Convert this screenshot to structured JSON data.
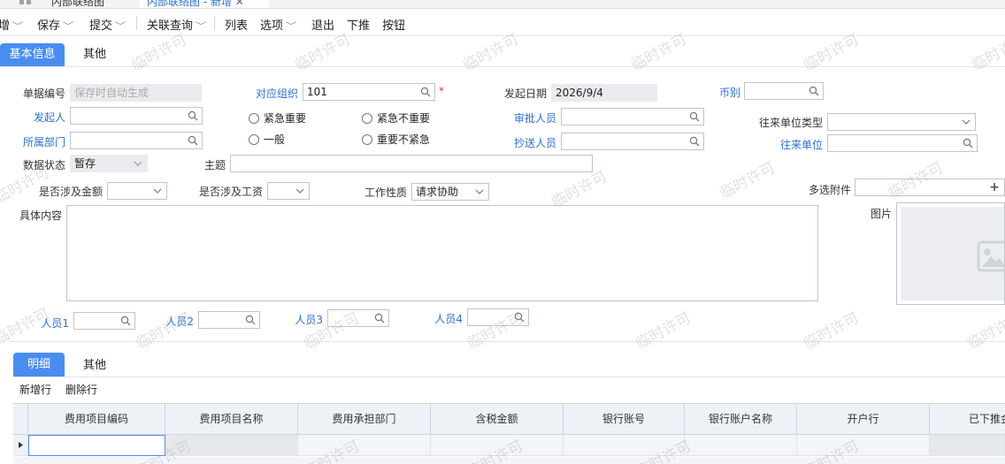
{
  "tabs": {
    "tab1": "内部联络图",
    "tab2": "内部联络图 - 新增"
  },
  "toolbar": {
    "items": [
      "增",
      "保存",
      "提交",
      "关联查询",
      "列表",
      "选项",
      "退出",
      "下推",
      "按钮"
    ]
  },
  "section_tabs": {
    "basic": "基本信息",
    "other": "其他"
  },
  "form": {
    "doc_no_label": "单据编号",
    "doc_no_placeholder": "保存时自动生成",
    "org_label": "对应组织",
    "org_value": "101",
    "start_date_label": "发起日期",
    "start_date_value": "2026/9/4",
    "currency_label": "币别",
    "initiator_label": "发起人",
    "dept_label": "所属部门",
    "urgency_options": [
      "紧急重要",
      "紧急不重要",
      "一般",
      "重要不紧急"
    ],
    "approver_label": "审批人员",
    "cc_label": "抄送人员",
    "partner_type_label": "往来单位类型",
    "partner_label": "往来单位",
    "status_label": "数据状态",
    "status_value": "暂存",
    "subject_label": "主题",
    "involve_amount_label": "是否涉及金额",
    "involve_salary_label": "是否涉及工资",
    "work_nature_label": "工作性质",
    "work_nature_value": "请求协助",
    "attachments_label": "多选附件",
    "content_label": "具体内容",
    "image_label": "图片",
    "person1_label": "人员1",
    "person2_label": "人员2",
    "person3_label": "人员3",
    "person4_label": "人员4"
  },
  "detail_tabs": {
    "detail": "明细",
    "other": "其他"
  },
  "detail_actions": {
    "add_row": "新增行",
    "delete_row": "删除行"
  },
  "grid": {
    "columns": [
      "费用项目编码",
      "费用项目名称",
      "费用承担部门",
      "含税金额",
      "银行账号",
      "银行账户名称",
      "开户行",
      "已下推金"
    ]
  },
  "watermark": "临时许可",
  "colors": {
    "accent": "#4a8df0",
    "link": "#2b6fd6",
    "required": "#e03030"
  }
}
